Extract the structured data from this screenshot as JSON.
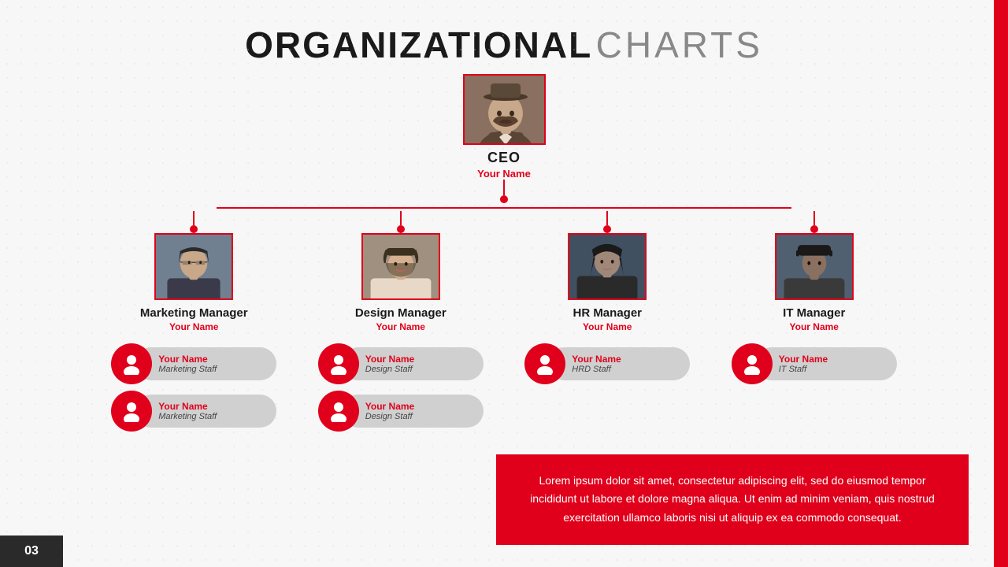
{
  "title": {
    "bold": "ORGANIZATIONAL",
    "light": "CHARTS"
  },
  "ceo": {
    "role": "CEO",
    "name": "Your Name"
  },
  "managers": [
    {
      "id": "marketing",
      "title": "Marketing Manager",
      "name": "Your Name",
      "photo_style": "photo-marketing",
      "staff": [
        {
          "name": "Your Name",
          "role": "Marketing Staff"
        },
        {
          "name": "Your Name",
          "role": "Marketing Staff"
        }
      ]
    },
    {
      "id": "design",
      "title": "Design Manager",
      "name": "Your Name",
      "photo_style": "photo-design",
      "staff": [
        {
          "name": "Your Name",
          "role": "Design Staff"
        },
        {
          "name": "Your Name",
          "role": "Design Staff"
        }
      ]
    },
    {
      "id": "hr",
      "title": "HR Manager",
      "name": "Your Name",
      "photo_style": "photo-hr",
      "staff": [
        {
          "name": "Your Name",
          "role": "HRD Staff"
        }
      ]
    },
    {
      "id": "it",
      "title": "IT Manager",
      "name": "Your Name",
      "photo_style": "photo-it",
      "staff": [
        {
          "name": "Your Name",
          "role": "IT Staff"
        }
      ]
    }
  ],
  "lorem": {
    "text": "Lorem ipsum dolor sit amet, consectetur adipiscing elit, sed do eiusmod tempor incididunt ut labore et dolore magna aliqua. Ut enim ad minim veniam, quis nostrud exercitation ullamco laboris nisi ut aliquip ex ea commodo consequat."
  },
  "page_number": "03",
  "colors": {
    "accent": "#e0001b",
    "dark": "#1a1a1a",
    "gray": "#888",
    "staff_bg": "#d0d0d0"
  },
  "icons": {
    "person": "person-silhouette"
  }
}
